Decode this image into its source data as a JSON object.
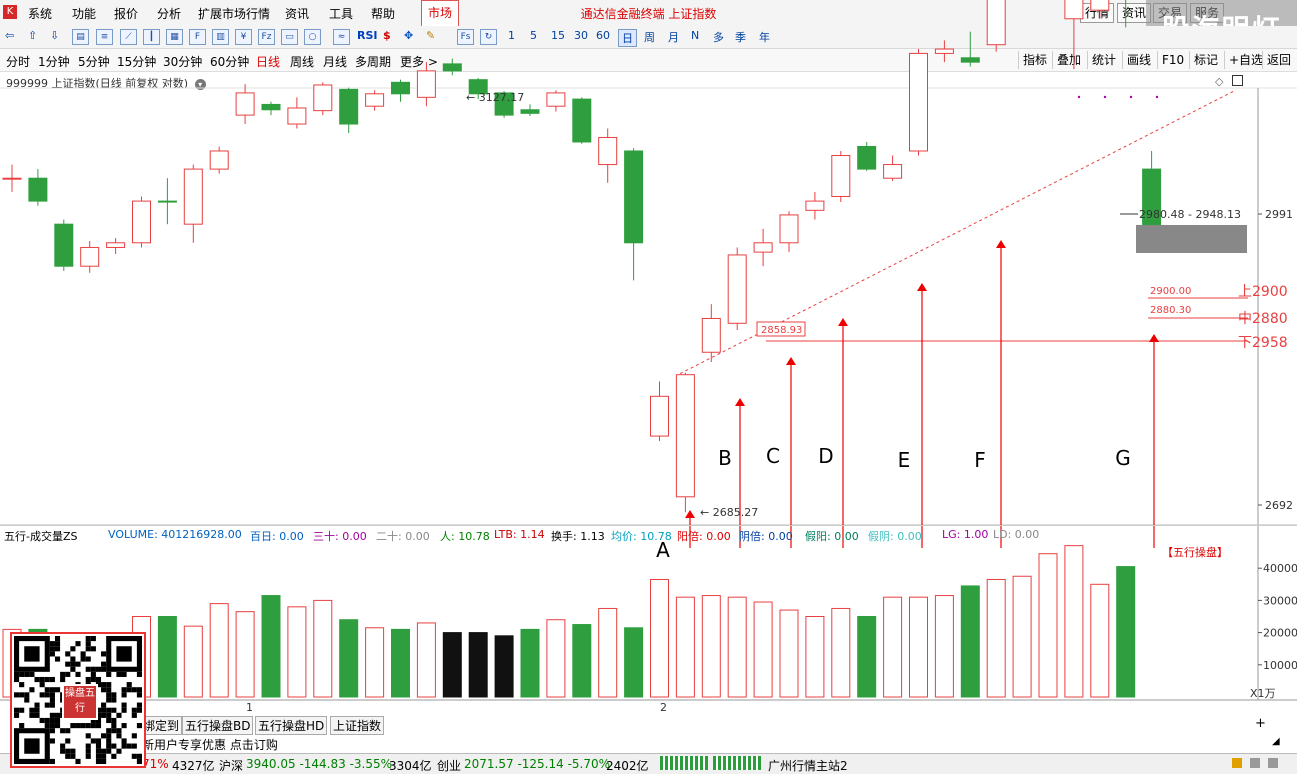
{
  "menu": {
    "items": [
      "系统",
      "功能",
      "报价",
      "分析",
      "扩展市场行情",
      "资讯",
      "工具",
      "帮助"
    ],
    "market_tab": "市场",
    "app_title": "通达信金融终端 上证指数",
    "right_buttons": [
      "行情",
      "资讯",
      "交易",
      "服务"
    ],
    "watermark": "股海明灯"
  },
  "toolbar": {
    "nums": [
      "1",
      "5",
      "15",
      "30",
      "60"
    ],
    "periods": [
      "日",
      "周",
      "月",
      "N",
      "多",
      "季",
      "年"
    ]
  },
  "periodbar": {
    "items": [
      "分时",
      "1分钟",
      "5分钟",
      "15分钟",
      "30分钟",
      "60分钟",
      "日线",
      "周线",
      "月线",
      "多周期",
      "更多 >"
    ],
    "active": "日线",
    "right_tabs": [
      "指标",
      "叠加",
      "统计",
      "画线",
      "F10",
      "标记",
      "+自选",
      "返回"
    ]
  },
  "chart_title": "999999 上证指数(日线 前复权 对数)",
  "chart_data": {
    "type": "candlestick",
    "price_axis": {
      "labels": [
        "2991",
        "2692"
      ],
      "values": [
        2991,
        2692
      ]
    },
    "annotations": {
      "high": "3127.17",
      "low": "2685.27",
      "mark": "2858.93",
      "range": "2980.48 - 2948.13",
      "box_hi": "2900.00",
      "box_lo": "2880.30"
    },
    "level_labels": [
      "上2900",
      "中2880",
      "下2958"
    ],
    "letters": [
      "A",
      "B",
      "C",
      "D",
      "E",
      "F",
      "G"
    ],
    "volume_axis": [
      "40000",
      "30000",
      "20000",
      "10000"
    ],
    "volume_unit": "X1万",
    "date_labels": [
      "1",
      "2"
    ],
    "candles": [
      {
        "o": 3030,
        "c": 3030,
        "h": 3045,
        "l": 3015,
        "up": true
      },
      {
        "o": 3030,
        "c": 3005,
        "h": 3040,
        "l": 3000,
        "up": false
      },
      {
        "o": 2980,
        "c": 2935,
        "h": 2985,
        "l": 2930,
        "up": false
      },
      {
        "o": 2935,
        "c": 2955,
        "h": 2962,
        "l": 2928,
        "up": true
      },
      {
        "o": 2955,
        "c": 2960,
        "h": 2965,
        "l": 2948,
        "up": true
      },
      {
        "o": 2960,
        "c": 3005,
        "h": 3010,
        "l": 2955,
        "up": true
      },
      {
        "o": 3005,
        "c": 3005,
        "h": 3030,
        "l": 2980,
        "up": false
      },
      {
        "o": 2980,
        "c": 3040,
        "h": 3045,
        "l": 2960,
        "up": true
      },
      {
        "o": 3040,
        "c": 3060,
        "h": 3065,
        "l": 3035,
        "up": true
      },
      {
        "o": 3100,
        "c": 3125,
        "h": 3135,
        "l": 3090,
        "up": true
      },
      {
        "o": 3112,
        "c": 3106,
        "h": 3115,
        "l": 3100,
        "up": false
      },
      {
        "o": 3090,
        "c": 3108,
        "h": 3120,
        "l": 3085,
        "up": true
      },
      {
        "o": 3105,
        "c": 3134,
        "h": 3137,
        "l": 3100,
        "up": true
      },
      {
        "o": 3129,
        "c": 3090,
        "h": 3131,
        "l": 3080,
        "up": false
      },
      {
        "o": 3110,
        "c": 3124,
        "h": 3128,
        "l": 3105,
        "up": true
      },
      {
        "o": 3124,
        "c": 3137,
        "h": 3140,
        "l": 3115,
        "up": false
      },
      {
        "o": 3120,
        "c": 3150,
        "h": 3160,
        "l": 3110,
        "up": true
      },
      {
        "o": 3150,
        "c": 3158,
        "h": 3164,
        "l": 3145,
        "up": false
      },
      {
        "o": 3140,
        "c": 3124,
        "h": 3142,
        "l": 3118,
        "up": false
      },
      {
        "o": 3125,
        "c": 3100,
        "h": 3127,
        "l": 3097,
        "up": false
      },
      {
        "o": 3102,
        "c": 3106,
        "h": 3112,
        "l": 3099,
        "up": false
      },
      {
        "o": 3110,
        "c": 3125,
        "h": 3128,
        "l": 3104,
        "up": true
      },
      {
        "o": 3118,
        "c": 3070,
        "h": 3120,
        "l": 3068,
        "up": false
      },
      {
        "o": 3045,
        "c": 3075,
        "h": 3085,
        "l": 3025,
        "up": true
      },
      {
        "o": 3060,
        "c": 2960,
        "h": 3063,
        "l": 2920,
        "up": false
      },
      {
        "o": 2760,
        "c": 2800,
        "h": 2815,
        "l": 2755,
        "up": true
      },
      {
        "o": 2700,
        "c": 2822,
        "h": 2824,
        "l": 2685,
        "up": true
      },
      {
        "o": 2845,
        "c": 2880,
        "h": 2895,
        "l": 2835,
        "up": true
      },
      {
        "o": 2875,
        "c": 2947,
        "h": 2955,
        "l": 2868,
        "up": true
      },
      {
        "o": 2950,
        "c": 2960,
        "h": 2975,
        "l": 2935,
        "up": true
      },
      {
        "o": 2960,
        "c": 2990,
        "h": 2994,
        "l": 2950,
        "up": true
      },
      {
        "o": 2995,
        "c": 3005,
        "h": 3015,
        "l": 2985,
        "up": true
      },
      {
        "o": 3010,
        "c": 3055,
        "h": 3060,
        "l": 3004,
        "up": true
      },
      {
        "o": 3065,
        "c": 3040,
        "h": 3070,
        "l": 3038,
        "up": false
      },
      {
        "o": 3030,
        "c": 3045,
        "h": 3055,
        "l": 3027,
        "up": true
      },
      {
        "o": 3060,
        "c": 3170,
        "h": 3175,
        "l": 3055,
        "up": true
      },
      {
        "o": 3170,
        "c": 3175,
        "h": 3185,
        "l": 3160,
        "up": true
      },
      {
        "o": 3165,
        "c": 3160,
        "h": 3195,
        "l": 3155,
        "up": false
      },
      {
        "o": 3180,
        "c": 3270,
        "h": 3272,
        "l": 3172,
        "up": true
      },
      {
        "o": 3280,
        "c": 3310,
        "h": 3335,
        "l": 3275,
        "up": true
      },
      {
        "o": 3295,
        "c": 3297,
        "h": 3310,
        "l": 3245,
        "up": true
      },
      {
        "o": 3210,
        "c": 3260,
        "h": 3264,
        "l": 3152,
        "up": true
      },
      {
        "o": 3220,
        "c": 3235,
        "h": 3285,
        "l": 3210,
        "up": true
      },
      {
        "o": 3260,
        "c": 3260,
        "h": 3270,
        "l": 3200,
        "up": false
      },
      {
        "o": 3040,
        "c": 2960,
        "h": 3060,
        "l": 2960,
        "up": false
      }
    ],
    "volumes": [
      21000,
      21000,
      20000,
      18000,
      18000,
      25000,
      25000,
      22000,
      29000,
      26500,
      31500,
      28000,
      30000,
      24000,
      21500,
      21000,
      23000,
      20000,
      20000,
      19000,
      21000,
      24000,
      22500,
      27500,
      21500,
      36500,
      31000,
      31500,
      31000,
      29500,
      27000,
      25000,
      27500,
      25000,
      31000,
      31000,
      31500,
      34500,
      36500,
      37500,
      44500,
      47000,
      35000,
      40500
    ],
    "vol_black_idx": [
      17,
      19
    ]
  },
  "vol_header": {
    "name": "五行-成交量ZS",
    "volume": "VOLUME: 401216928.00",
    "baiRi": "百日: 0.00",
    "sanShi": "三十: 0.00",
    "erShi": "二十: 0.00",
    "ren": "人: 10.78",
    "ltb": "LTB: 1.14",
    "huanShou": "换手: 1.13",
    "junJia": "均价: 10.78",
    "yangBei": "阳倍: 0.00",
    "yinBei": "阴倍: 0.00",
    "jiaYang": "假阳: 0.00",
    "jiaYin": "假阴: 0.00",
    "lg": "LG: 1.00",
    "ld": "LD: 0.00",
    "tag": "【五行操盘】"
  },
  "bottom_tabs": [
    "绑定到",
    "五行操盘BD",
    "五行操盘HD",
    "上证指数"
  ],
  "bottom_promo": "新用户专享优惠 点击订购",
  "status": {
    "s1": "71%",
    "s2": "4327亿",
    "hushen_label": "沪深",
    "hushen": "3940.05 -144.83 -3.55%",
    "s3": "3304亿",
    "chuangye_label": "创业",
    "chuangye": "2071.57 -125.14 -5.70%",
    "s4": "2402亿",
    "server": "广州行情主站2"
  },
  "qr_logo": "操盘五行",
  "colors": {
    "up": "#e84040",
    "down": "#2f9e3f",
    "axis": "#555555"
  }
}
